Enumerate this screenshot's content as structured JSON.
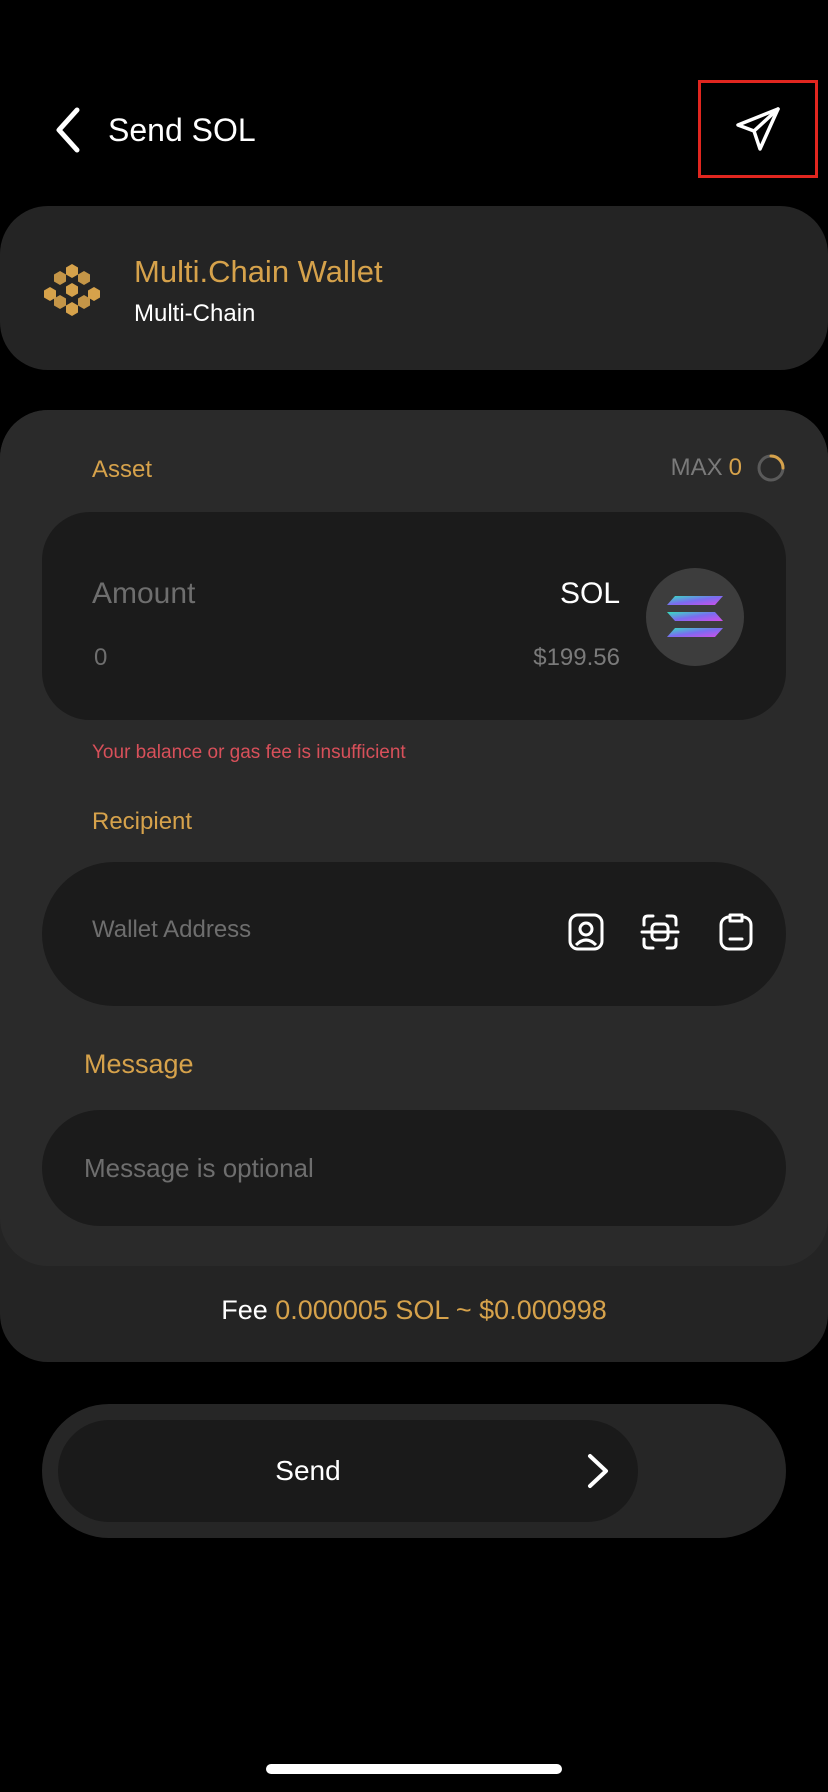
{
  "header": {
    "title": "Send SOL"
  },
  "wallet": {
    "name": "Multi.Chain Wallet",
    "chain": "Multi-Chain"
  },
  "asset": {
    "label": "Asset",
    "max_label": "MAX",
    "max_value": "0",
    "amount_placeholder": "Amount",
    "amount_value": "0",
    "token_symbol": "SOL",
    "token_price": "$199.56"
  },
  "error": {
    "message": "Your balance or gas fee is insufficient"
  },
  "recipient": {
    "label": "Recipient",
    "placeholder": "Wallet Address"
  },
  "message": {
    "label": "Message",
    "placeholder": "Message is optional"
  },
  "fee": {
    "label": "Fee",
    "value": "0.000005 SOL ~ $0.000998"
  },
  "send": {
    "label": "Send"
  },
  "colors": {
    "accent": "#d6a24b",
    "error": "#d8505a",
    "highlight": "#e0261f"
  },
  "icons": [
    "chevron-left-icon",
    "paper-plane-icon",
    "multichain-logo-icon",
    "spinner-icon",
    "solana-icon",
    "contact-icon",
    "scan-icon",
    "paste-icon",
    "chevron-right-icon"
  ]
}
